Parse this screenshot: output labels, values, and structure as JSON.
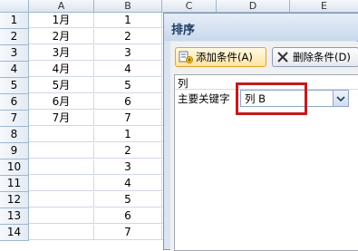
{
  "sheet": {
    "columns": [
      "A",
      "B",
      "C",
      "D",
      "E"
    ],
    "rows": [
      {
        "num": "1",
        "a": "1月",
        "b": "1"
      },
      {
        "num": "2",
        "a": "2月",
        "b": "2"
      },
      {
        "num": "3",
        "a": "3月",
        "b": "3"
      },
      {
        "num": "4",
        "a": "4月",
        "b": "4"
      },
      {
        "num": "5",
        "a": "5月",
        "b": "5"
      },
      {
        "num": "6",
        "a": "6月",
        "b": "6"
      },
      {
        "num": "7",
        "a": "7月",
        "b": "7"
      },
      {
        "num": "8",
        "a": "",
        "b": "1"
      },
      {
        "num": "9",
        "a": "",
        "b": "2"
      },
      {
        "num": "10",
        "a": "",
        "b": "3"
      },
      {
        "num": "11",
        "a": "",
        "b": "4"
      },
      {
        "num": "12",
        "a": "",
        "b": "5"
      },
      {
        "num": "13",
        "a": "",
        "b": "6"
      },
      {
        "num": "14",
        "a": "",
        "b": "7"
      }
    ]
  },
  "dialog": {
    "title": "排序",
    "add_button": "添加条件(A)",
    "delete_button": "删除条件(D)",
    "list_header": "列",
    "key_label": "主要关键字",
    "selected_value": "列 B"
  },
  "colors": {
    "highlight": "#c21b1b",
    "dialog_bg": "#dbe5f1"
  }
}
